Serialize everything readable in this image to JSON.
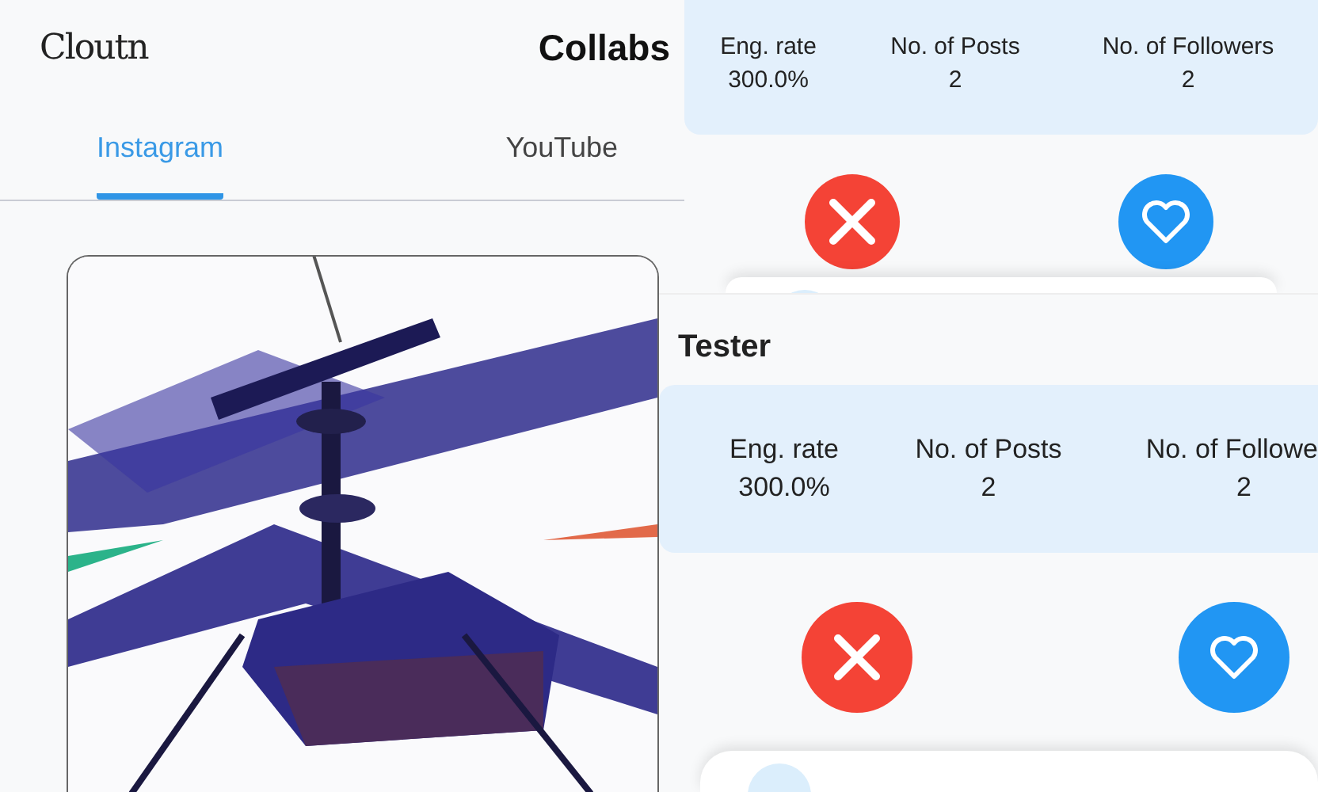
{
  "header": {
    "logo": "Cloutn",
    "title": "Collabs"
  },
  "tabs": [
    {
      "label": "Instagram",
      "selected": true
    },
    {
      "label": "YouTube",
      "selected": false
    }
  ],
  "profile_cards": [
    {
      "stats": [
        {
          "label": "Eng. rate",
          "value": "300.0%"
        },
        {
          "label": "No. of Posts",
          "value": "2"
        },
        {
          "label": "No. of Followers",
          "value": "2"
        }
      ],
      "actions": [
        {
          "kind": "reject"
        },
        {
          "kind": "like"
        }
      ]
    },
    {
      "name": "Tester",
      "stats": [
        {
          "label": "Eng. rate",
          "value": "300.0%"
        },
        {
          "label": "No. of Posts",
          "value": "2"
        },
        {
          "label": "No. of Followe",
          "value": "2"
        }
      ],
      "actions": [
        {
          "kind": "reject"
        },
        {
          "kind": "like"
        }
      ]
    }
  ]
}
